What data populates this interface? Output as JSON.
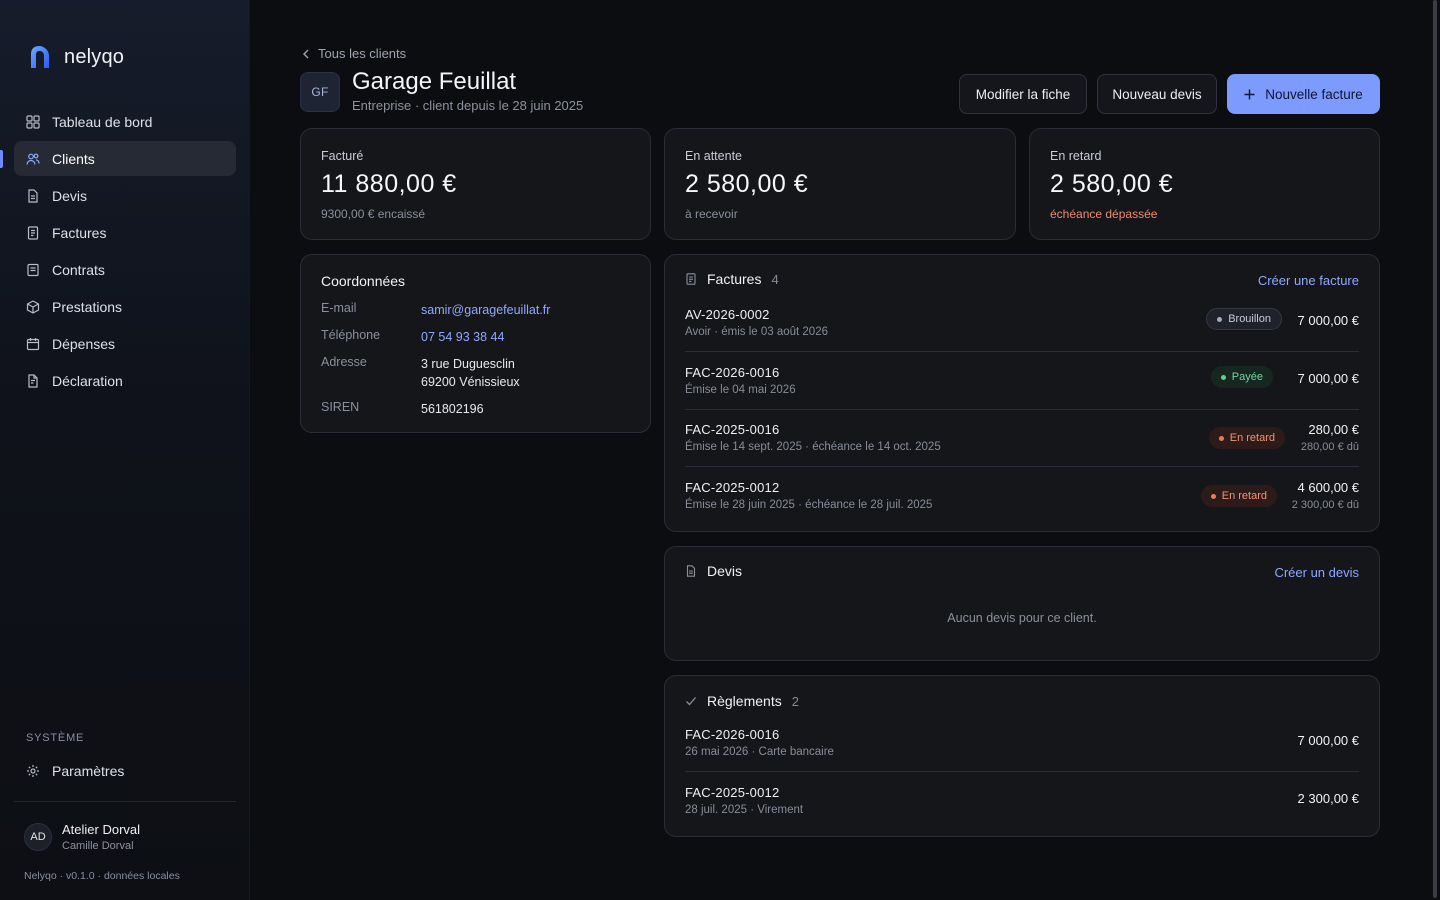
{
  "brand": {
    "name": "nelyqo"
  },
  "sidebar": {
    "items": [
      {
        "label": "Tableau de bord",
        "icon": "dashboard-icon",
        "active": false
      },
      {
        "label": "Clients",
        "icon": "users-icon",
        "active": true
      },
      {
        "label": "Devis",
        "icon": "document-icon",
        "active": false
      },
      {
        "label": "Factures",
        "icon": "invoice-icon",
        "active": false
      },
      {
        "label": "Contrats",
        "icon": "contract-icon",
        "active": false
      },
      {
        "label": "Prestations",
        "icon": "box-icon",
        "active": false
      },
      {
        "label": "Dépenses",
        "icon": "calendar-icon",
        "active": false
      },
      {
        "label": "Déclaration",
        "icon": "declaration-icon",
        "active": false
      }
    ],
    "system_label": "SYSTÈME",
    "settings_label": "Paramètres",
    "user": {
      "initials": "AD",
      "name": "Atelier Dorval",
      "sub": "Camille Dorval"
    },
    "version": "Nelyqo · v0.1.0 · données locales"
  },
  "header": {
    "back_label": "Tous les clients",
    "initials": "GF",
    "name": "Garage Feuillat",
    "sub": "Entreprise · client depuis le 28 juin 2025",
    "edit_label": "Modifier la fiche",
    "new_devis_label": "Nouveau devis",
    "new_invoice_label": "Nouvelle facture"
  },
  "stats": [
    {
      "label": "Facturé",
      "value": "11 880,00 €",
      "note": "9300,00 € encaissé"
    },
    {
      "label": "En attente",
      "value": "2 580,00 €",
      "note": "à recevoir"
    },
    {
      "label": "En retard",
      "value": "2 580,00 €",
      "note": "échéance dépassée"
    }
  ],
  "coordinates": {
    "title": "Coordonnées",
    "email_label": "E-mail",
    "email": "samir@garagefeuillat.fr",
    "phone_label": "Téléphone",
    "phone": "07 54 93 38 44",
    "address_label": "Adresse",
    "address_line1": "3 rue Duguesclin",
    "address_line2": "69200 Vénissieux",
    "siren_label": "SIREN",
    "siren": "561802196"
  },
  "invoices": {
    "title": "Factures",
    "count": "4",
    "action": "Créer une facture",
    "rows": [
      {
        "id": "AV-2026-0002",
        "sub": "Avoir · émis le 03 août 2026",
        "status": "Brouillon",
        "amount": "7 000,00 €",
        "due": ""
      },
      {
        "id": "FAC-2026-0016",
        "sub": "Émise le 04 mai 2026",
        "status": "Payée",
        "amount": "7 000,00 €",
        "due": ""
      },
      {
        "id": "FAC-2025-0016",
        "sub": "Émise le 14 sept. 2025 · échéance le 14 oct. 2025",
        "status": "En retard",
        "amount": "280,00 €",
        "due": "280,00 € dû"
      },
      {
        "id": "FAC-2025-0012",
        "sub": "Émise le 28 juin 2025 · échéance le 28 juil. 2025",
        "status": "En retard",
        "amount": "4 600,00 €",
        "due": "2 300,00 € dû"
      }
    ]
  },
  "devis": {
    "title": "Devis",
    "action": "Créer un devis",
    "empty": "Aucun devis pour ce client."
  },
  "payments": {
    "title": "Règlements",
    "count": "2",
    "rows": [
      {
        "id": "FAC-2026-0016",
        "sub": "26 mai 2026 · Carte bancaire",
        "amount": "7 000,00 €"
      },
      {
        "id": "FAC-2025-0012",
        "sub": "28 juil. 2025 · Virement",
        "amount": "2 300,00 €"
      }
    ]
  },
  "colors": {
    "accent": "#7d9bff",
    "link": "#8ea8ff",
    "late": "#f0927a",
    "paid": "#72d69a"
  }
}
